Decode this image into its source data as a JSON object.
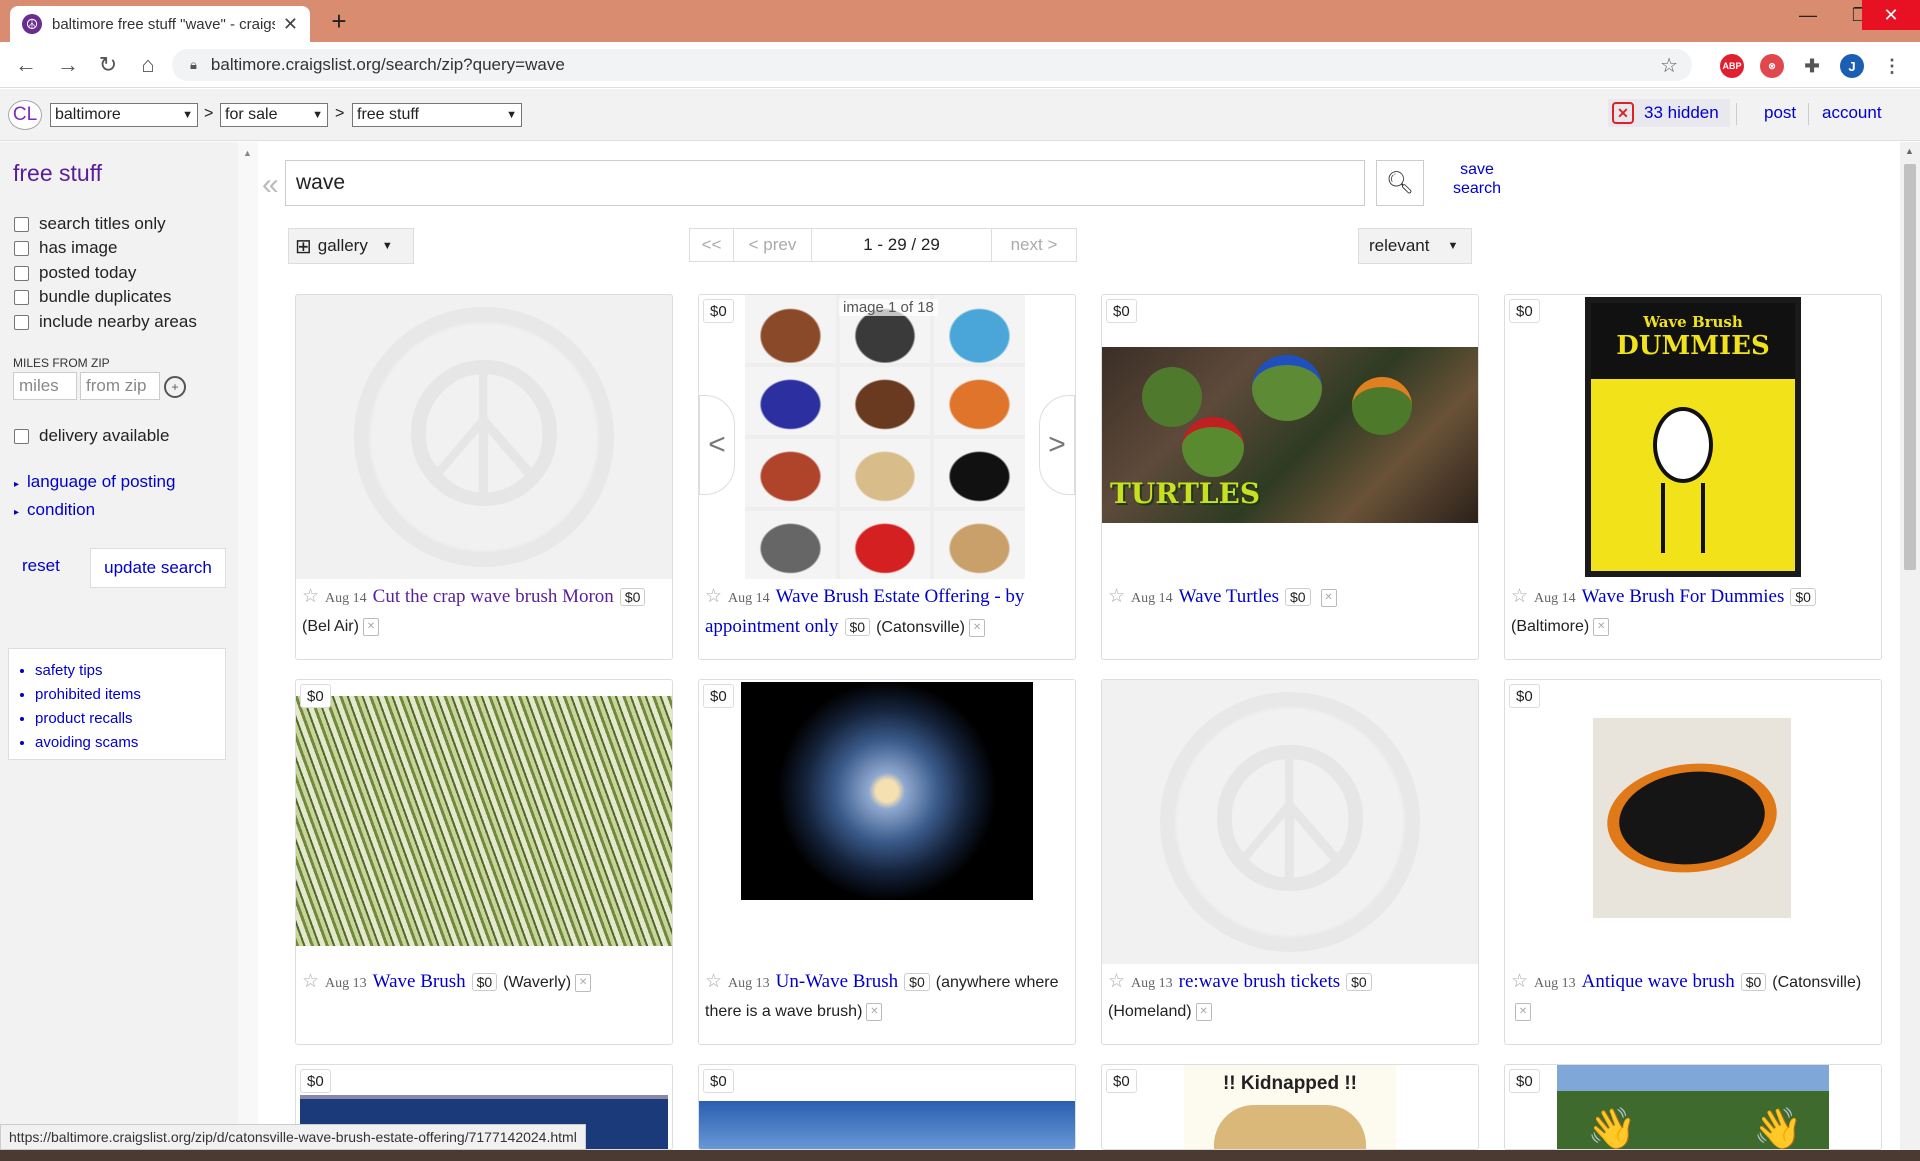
{
  "browser": {
    "tab_title": "baltimore free stuff \"wave\" - craigslist",
    "url": "baltimore.craigslist.org/search/zip?query=wave",
    "new_tab": "+",
    "profile_initial": "J"
  },
  "header": {
    "logo": "CL",
    "area": "baltimore",
    "category": "for sale",
    "subcategory": "free stuff",
    "separator": ">",
    "hidden_count": "33 hidden",
    "post": "post",
    "account": "account"
  },
  "sidebar": {
    "title": "free stuff",
    "checkboxes": [
      "search titles only",
      "has image",
      "posted today",
      "bundle duplicates",
      "include nearby areas"
    ],
    "miles_label": "MILES FROM ZIP",
    "miles_placeholder": "miles",
    "zip_placeholder": "from zip",
    "delivery": "delivery available",
    "expanders": [
      "language of posting",
      "condition"
    ],
    "reset": "reset",
    "update": "update search",
    "links": [
      "safety tips",
      "prohibited items",
      "product recalls",
      "avoiding scams"
    ]
  },
  "search": {
    "query": "wave",
    "save_line1": "save",
    "save_line2": "search",
    "view": "gallery",
    "pager": {
      "first": "<<",
      "prev": "< prev",
      "range": "1 - 29 / 29",
      "next": "next >"
    },
    "sort": "relevant"
  },
  "results": [
    {
      "price": "$0",
      "date": "Aug 14",
      "title": "Cut the crap wave brush Moron",
      "location": "(Bel Air)",
      "image": "placeholder"
    },
    {
      "price": "$0",
      "date": "Aug 14",
      "title": "Wave Brush Estate Offering - by appointment only",
      "location": "(Catonsville)",
      "image": "brushes",
      "image_counter": "image 1 of 18"
    },
    {
      "price": "$0",
      "date": "Aug 14",
      "title": "Wave Turtles",
      "location": "",
      "image": "turtles",
      "image_caption": "TURTLES"
    },
    {
      "price": "$0",
      "date": "Aug 14",
      "title": "Wave Brush For Dummies",
      "location": "(Baltimore)",
      "image": "dummies",
      "image_caption_top": "Wave Brush",
      "image_caption_bottom": "DUMMIES"
    },
    {
      "price": "$0",
      "date": "Aug 13",
      "title": "Wave Brush",
      "location": "(Waverly)",
      "image": "grass"
    },
    {
      "price": "$0",
      "date": "Aug 13",
      "title": "Un-Wave Brush",
      "location": "(anywhere where there is a wave brush)",
      "image": "galaxy"
    },
    {
      "price": "$0",
      "date": "Aug 13",
      "title": "re:wave brush tickets",
      "location": "(Homeland)",
      "image": "placeholder"
    },
    {
      "price": "$0",
      "date": "Aug 13",
      "title": "Antique wave brush",
      "location": "(Catonsville)",
      "image": "brush"
    },
    {
      "price": "$0",
      "image": "blue"
    },
    {
      "price": "$0",
      "image": "sky"
    },
    {
      "price": "$0",
      "image": "kidnapped",
      "image_caption": "!! Kidnapped !!"
    },
    {
      "price": "$0",
      "image": "hands"
    }
  ],
  "status_url": "https://baltimore.craigslist.org/zip/d/catonsville-wave-brush-estate-offering/7177142024.html"
}
